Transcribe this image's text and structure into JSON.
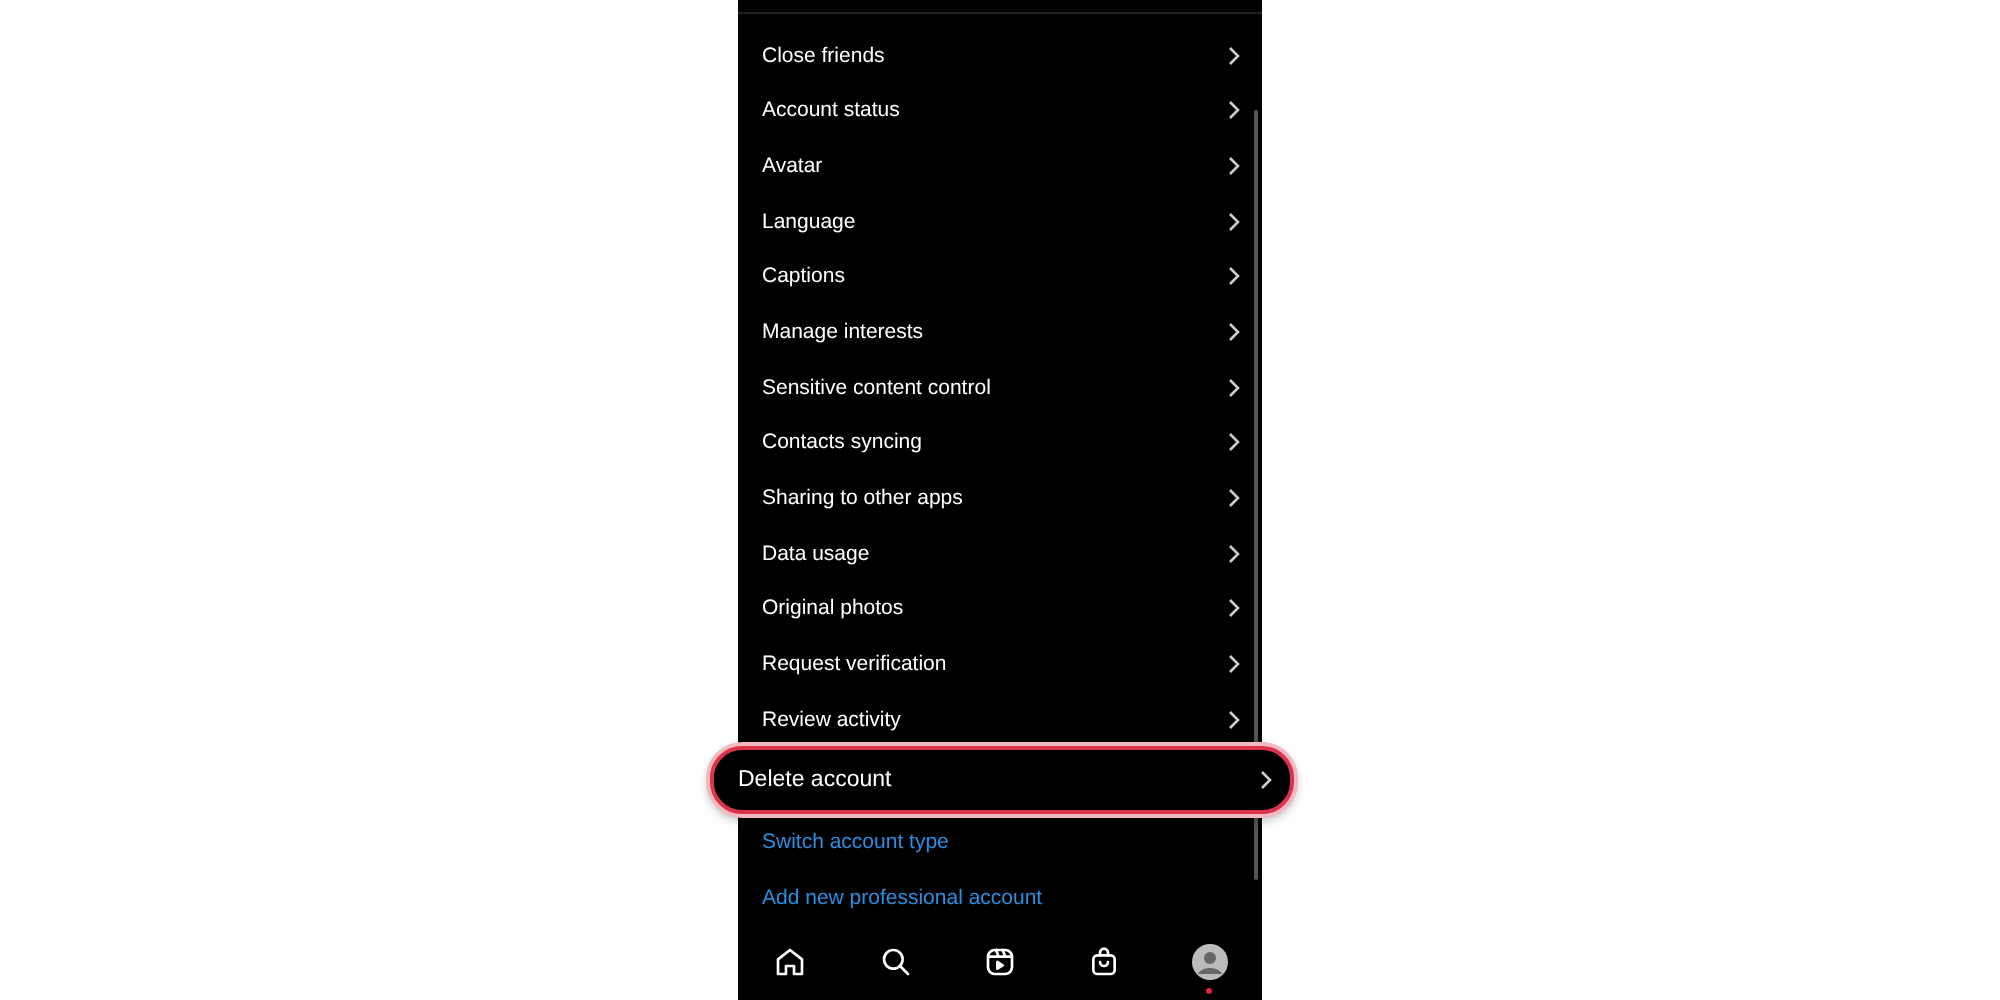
{
  "settings_items": [
    {
      "label": "Close friends",
      "kind": "plain"
    },
    {
      "label": "Account status",
      "kind": "plain"
    },
    {
      "label": "Avatar",
      "kind": "plain"
    },
    {
      "label": "Language",
      "kind": "plain"
    },
    {
      "label": "Captions",
      "kind": "plain"
    },
    {
      "label": "Manage interests",
      "kind": "plain"
    },
    {
      "label": "Sensitive content control",
      "kind": "plain"
    },
    {
      "label": "Contacts syncing",
      "kind": "plain"
    },
    {
      "label": "Sharing to other apps",
      "kind": "plain"
    },
    {
      "label": "Data usage",
      "kind": "plain"
    },
    {
      "label": "Original photos",
      "kind": "plain"
    },
    {
      "label": "Request verification",
      "kind": "plain"
    },
    {
      "label": "Review activity",
      "kind": "plain"
    },
    {
      "label": "Delete account",
      "kind": "highlighted"
    }
  ],
  "links": [
    "Switch account type",
    "Add new professional account"
  ],
  "nav": [
    {
      "kind": "home"
    },
    {
      "kind": "search"
    },
    {
      "kind": "reels"
    },
    {
      "kind": "shop"
    },
    {
      "kind": "profile",
      "badge": true
    }
  ]
}
